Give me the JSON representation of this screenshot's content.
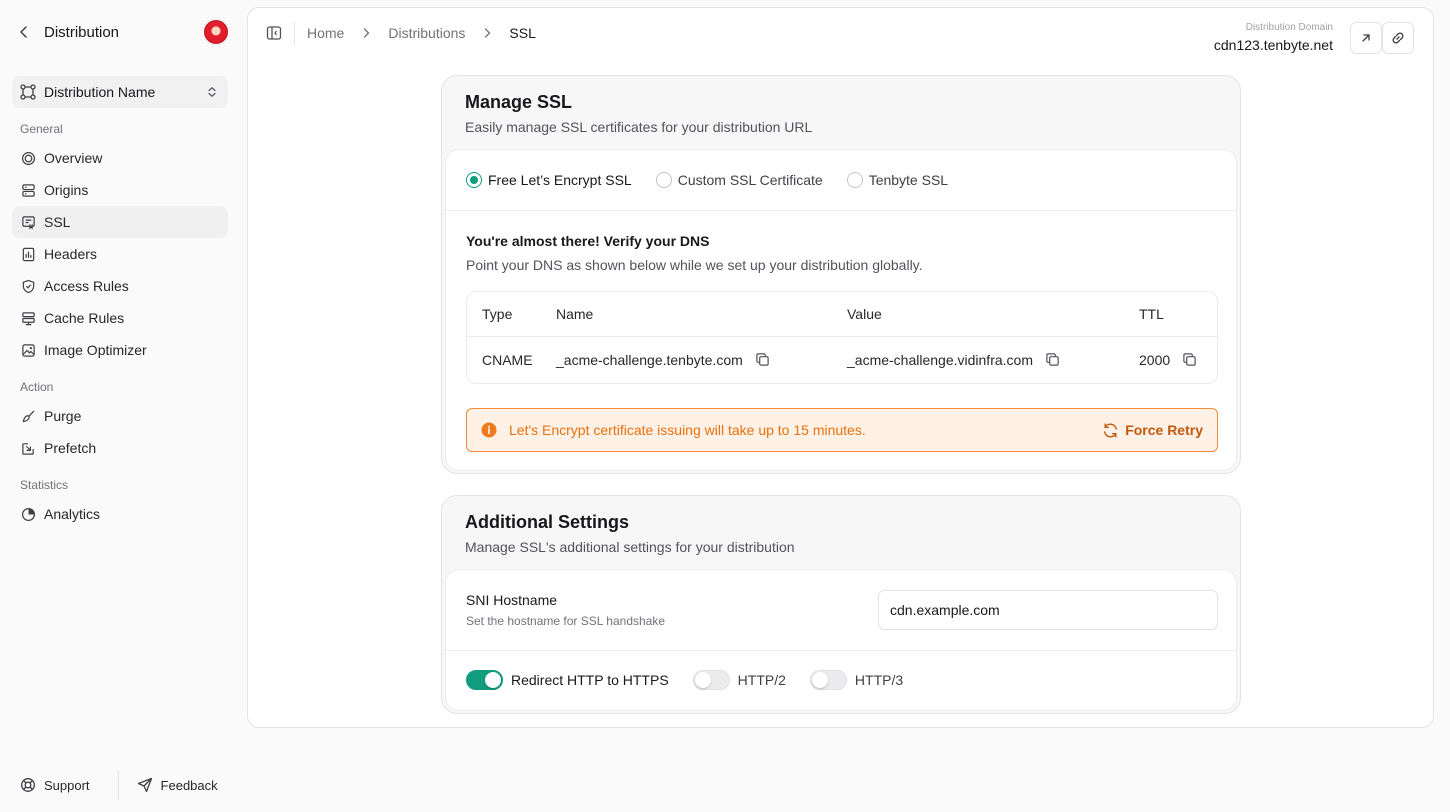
{
  "sidebar": {
    "title": "Distribution",
    "distribution_select": "Distribution Name",
    "groups": {
      "general": "General",
      "action": "Action",
      "statistics": "Statistics"
    },
    "items": {
      "overview": "Overview",
      "origins": "Origins",
      "ssl": "SSL",
      "headers": "Headers",
      "access_rules": "Access Rules",
      "cache_rules": "Cache Rules",
      "image_optimizer": "Image Optimizer",
      "purge": "Purge",
      "prefetch": "Prefetch",
      "analytics": "Analytics"
    },
    "active_item": "SSL",
    "footer": {
      "support": "Support",
      "feedback": "Feedback"
    }
  },
  "header": {
    "breadcrumb": [
      "Home",
      "Distributions",
      "SSL"
    ],
    "domain_label": "Distribution Domain",
    "domain_value": "cdn123.tenbyte.net"
  },
  "manage_ssl": {
    "title": "Manage SSL",
    "subtitle": "Easily manage SSL certificates for your distribution URL",
    "options": [
      "Free Let’s Encrypt SSL",
      "Custom SSL Certificate",
      "Tenbyte SSL"
    ],
    "selected_option": "Free Let’s Encrypt SSL",
    "verify_title": "You're almost there! Verify your DNS",
    "verify_subtitle": "Point your DNS as shown below while we set up your distribution globally.",
    "dns_table": {
      "headers": [
        "Type",
        "Name",
        "Value",
        "TTL"
      ],
      "row": {
        "type": "CNAME",
        "name": "_acme-challenge.tenbyte.com",
        "value": "_acme-challenge.vidinfra.com",
        "ttl": "2000"
      }
    },
    "alert_text": "Let's Encrypt certificate issuing will take up to 15 minutes.",
    "retry_label": "Force Retry"
  },
  "additional": {
    "title": "Additional Settings",
    "subtitle": "Manage SSL's additional settings for your distribution",
    "sni_label": "SNI Hostname",
    "sni_help": "Set the hostname for SSL handshake",
    "sni_value": "cdn.example.com",
    "toggles": {
      "redirect": {
        "label": "Redirect HTTP to HTTPS",
        "on": true
      },
      "http2": {
        "label": "HTTP/2",
        "on": false
      },
      "http3": {
        "label": "HTTP/3",
        "on": false
      }
    }
  },
  "colors": {
    "accent": "#0f9d7e",
    "warning_bg": "#fff1e6",
    "warning_border": "#f28a3a",
    "warning_text": "#e8710f"
  }
}
